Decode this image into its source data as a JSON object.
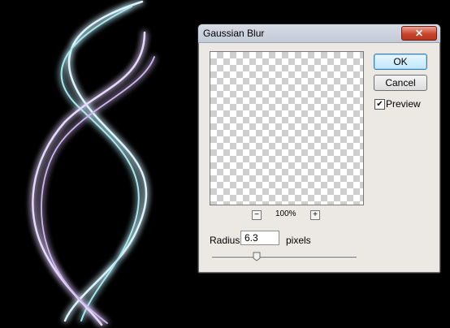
{
  "dialog": {
    "title": "Gaussian Blur",
    "close_icon": "close-icon",
    "ok_label": "OK",
    "cancel_label": "Cancel",
    "preview_checked": true,
    "preview_label": "Preview",
    "zoom_level": "100%",
    "zoom_out_label": "−",
    "zoom_in_label": "+",
    "radius_label": "Radius:",
    "radius_value": "6.3",
    "radius_unit": "pixels"
  }
}
